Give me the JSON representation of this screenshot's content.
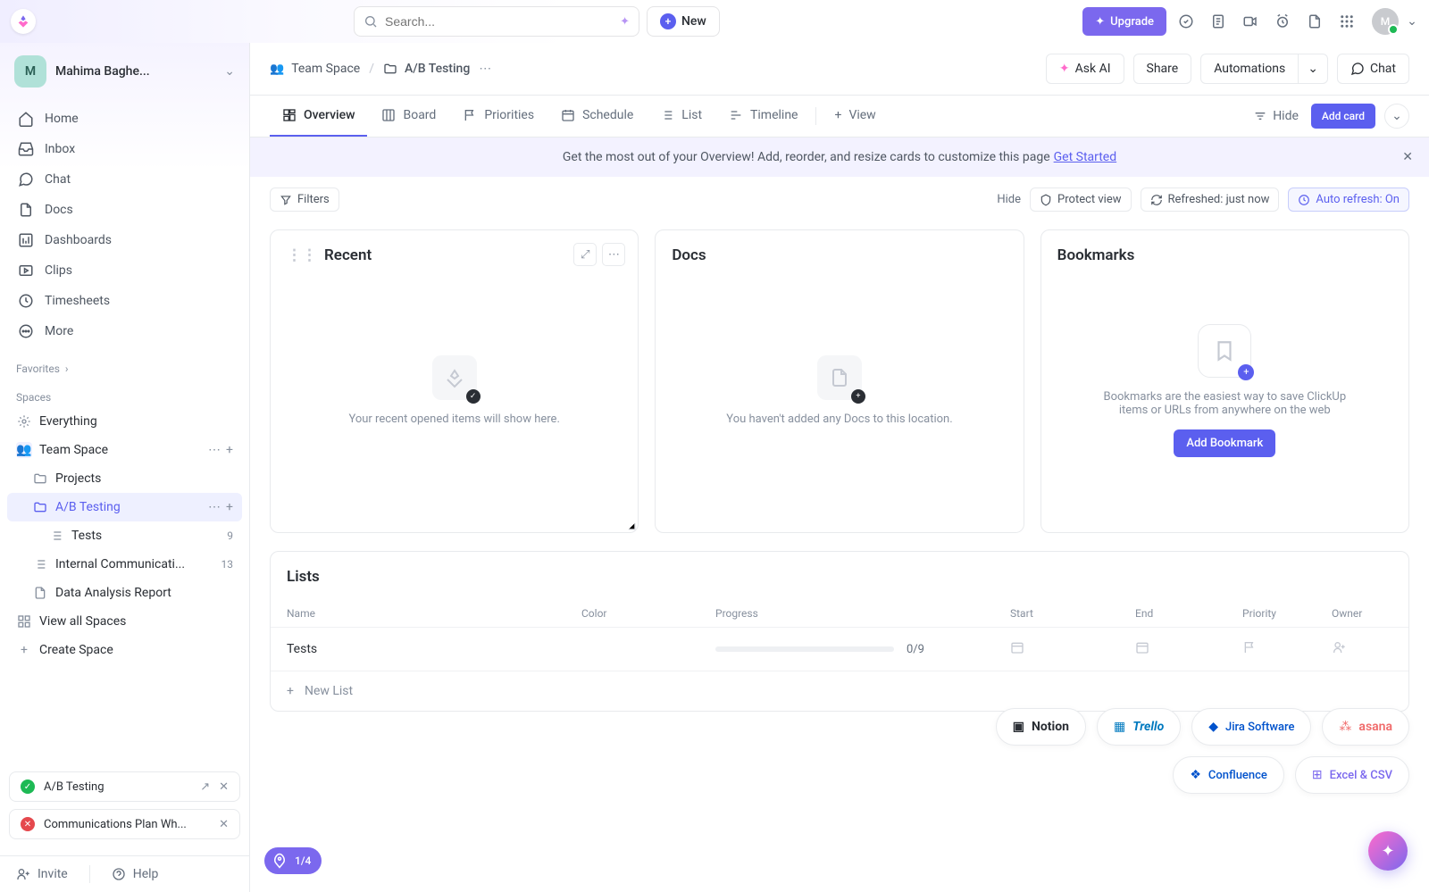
{
  "topbar": {
    "search_placeholder": "Search...",
    "new_label": "New",
    "upgrade_label": "Upgrade",
    "avatar_letter": "M"
  },
  "workspace": {
    "avatar_letter": "M",
    "name": "Mahima Baghe..."
  },
  "nav": [
    {
      "icon": "home-icon",
      "label": "Home"
    },
    {
      "icon": "inbox-icon",
      "label": "Inbox"
    },
    {
      "icon": "chat-icon",
      "label": "Chat"
    },
    {
      "icon": "doc-icon",
      "label": "Docs"
    },
    {
      "icon": "dashboard-icon",
      "label": "Dashboards"
    },
    {
      "icon": "clip-icon",
      "label": "Clips"
    },
    {
      "icon": "clock-icon",
      "label": "Timesheets"
    },
    {
      "icon": "more-icon",
      "label": "More"
    }
  ],
  "sections": {
    "favorites": "Favorites",
    "spaces": "Spaces"
  },
  "tree": {
    "everything": "Everything",
    "team_space": "Team Space",
    "projects": "Projects",
    "ab_testing": "A/B Testing",
    "tests": "Tests",
    "tests_count": "9",
    "internal": "Internal Communicati...",
    "internal_count": "13",
    "data_report": "Data Analysis Report",
    "view_all": "View all Spaces",
    "create_space": "Create Space"
  },
  "bottom_cards": [
    {
      "status": "green",
      "label": "A/B Testing"
    },
    {
      "status": "red",
      "label": "Communications Plan Wh..."
    }
  ],
  "footer": {
    "invite": "Invite",
    "help": "Help"
  },
  "breadcrumb": {
    "space": "Team Space",
    "folder": "A/B Testing"
  },
  "header_actions": {
    "ask_ai": "Ask AI",
    "share": "Share",
    "automations": "Automations",
    "chat": "Chat"
  },
  "tabs": [
    "Overview",
    "Board",
    "Priorities",
    "Schedule",
    "List",
    "Timeline"
  ],
  "tab_view": "View",
  "hide_label": "Hide",
  "add_card_label": "Add card",
  "banner": {
    "text": "Get the most out of your Overview! Add, reorder, and resize cards to customize this page",
    "link": "Get Started"
  },
  "toolbar": {
    "filters": "Filters",
    "hide": "Hide",
    "protect": "Protect view",
    "refreshed": "Refreshed: just now",
    "auto_refresh": "Auto refresh: On"
  },
  "cards": {
    "recent": {
      "title": "Recent",
      "empty": "Your recent opened items will show here."
    },
    "docs": {
      "title": "Docs",
      "empty": "You haven't added any Docs to this location."
    },
    "bookmarks": {
      "title": "Bookmarks",
      "desc": "Bookmarks are the easiest way to save ClickUp items or URLs from anywhere on the web",
      "btn": "Add Bookmark"
    }
  },
  "lists": {
    "title": "Lists",
    "headers": {
      "name": "Name",
      "color": "Color",
      "progress": "Progress",
      "start": "Start",
      "end": "End",
      "priority": "Priority",
      "owner": "Owner"
    },
    "rows": [
      {
        "name": "Tests",
        "progress_text": "0/9"
      }
    ],
    "new_list": "New List"
  },
  "integrations": [
    "Notion",
    "Trello",
    "Jira Software",
    "asana",
    "Confluence",
    "Excel & CSV"
  ],
  "progress_pill": "1/4"
}
